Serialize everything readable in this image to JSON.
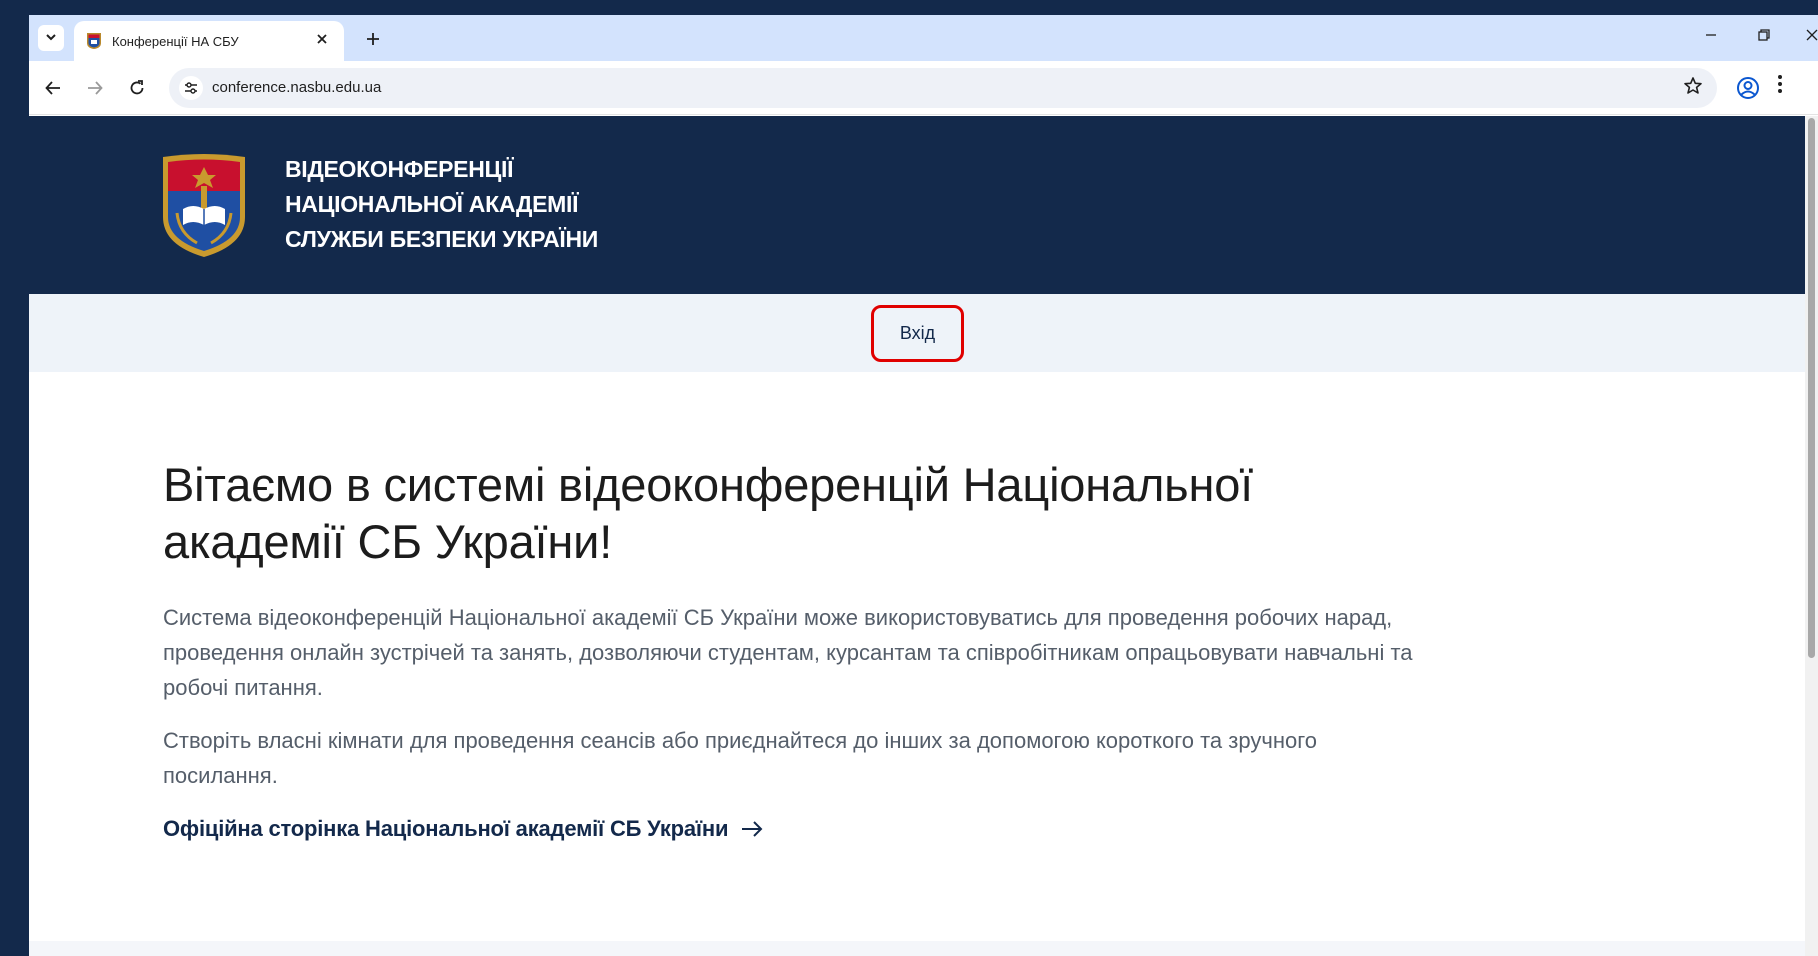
{
  "browser": {
    "tab_title": "Конференції НА СБУ",
    "url": "conference.nasbu.edu.ua"
  },
  "header": {
    "title_lines": [
      "ВІДЕОКОНФЕРЕНЦІЇ",
      "НАЦІОНАЛЬНОЇ АКАДЕМІЇ",
      "СЛУЖБИ БЕЗПЕКИ УКРАЇНИ"
    ]
  },
  "nav": {
    "login_label": "Вхід"
  },
  "main": {
    "heading": "Вітаємо в системі відеоконференцій Національної академії СБ України!",
    "paragraph1": "Система відеоконференцій Національної академії СБ України може використовуватись для проведення робочих нарад, проведення онлайн зустрічей та занять, дозволяючи студентам, курсантам та співробітникам опрацьовувати навчальні та робочі питання.",
    "paragraph2": "Створіть власні кімнати для проведення сеансів або приєднайтеся до інших за допомогою короткого та зручного посилання.",
    "official_link": "Офіційна сторінка Національної академії СБ України"
  },
  "icons": {
    "tab_search": "chevron-down-icon",
    "tab_close": "close-icon",
    "new_tab": "plus-icon",
    "back": "arrow-left-icon",
    "forward": "arrow-right-icon",
    "reload": "reload-icon",
    "site_info": "tune-icon",
    "bookmark": "star-icon",
    "profile": "profile-icon",
    "menu": "more-vert-icon",
    "link_arrow": "arrow-right-icon"
  },
  "colors": {
    "brand_navy": "#13294b",
    "nav_bg": "#eef3f9",
    "highlight_red": "#e00000",
    "tabstrip_bg": "#d3e3fd"
  }
}
